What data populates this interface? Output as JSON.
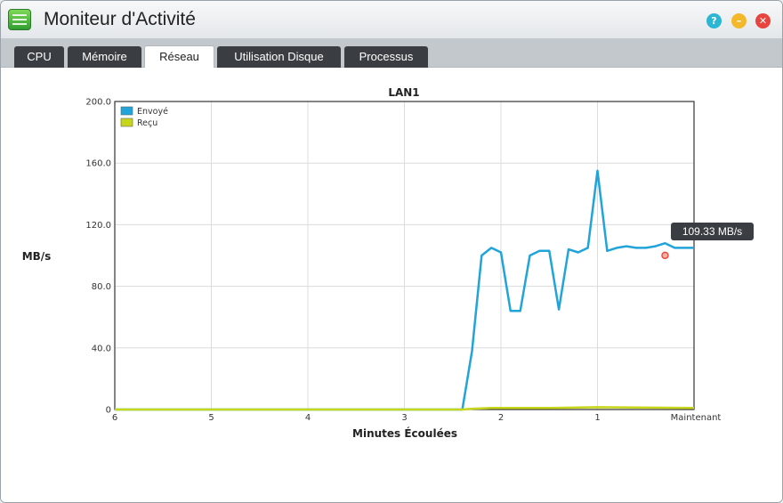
{
  "window": {
    "title": "Moniteur d'Activité"
  },
  "tabs": [
    {
      "label": "CPU"
    },
    {
      "label": "Mémoire"
    },
    {
      "label": "Réseau"
    },
    {
      "label": "Utilisation Disque"
    },
    {
      "label": "Processus"
    }
  ],
  "active_tab": "Réseau",
  "colors": {
    "sent": "#20a4d9",
    "received": "#c7d61a",
    "marker": "#e84c3d"
  },
  "tooltip": {
    "text": "109.33 MB/s"
  },
  "chart_data": {
    "type": "line",
    "title": "LAN1",
    "xlabel": "Minutes Écoulées",
    "ylabel": "MB/s",
    "ylim": [
      0,
      200
    ],
    "yticks": [
      "0",
      "40.0",
      "80.0",
      "120.0",
      "160.0",
      "200.0"
    ],
    "xticks": [
      "6",
      "5",
      "4",
      "3",
      "2",
      "1",
      "Maintenant"
    ],
    "xlim": [
      6,
      0
    ],
    "grid": true,
    "legend_position": "top-left",
    "series": [
      {
        "name": "Envoyé",
        "x": [
          6,
          2.4,
          2.3,
          2.2,
          2.1,
          2.0,
          1.9,
          1.8,
          1.7,
          1.6,
          1.5,
          1.4,
          1.3,
          1.2,
          1.1,
          1.0,
          0.9,
          0.8,
          0.7,
          0.6,
          0.5,
          0.4,
          0.3,
          0.2,
          0.1,
          0
        ],
        "y": [
          0,
          0,
          38,
          100,
          105,
          102,
          64,
          64,
          100,
          103,
          103,
          65,
          104,
          102,
          105,
          155,
          103,
          105,
          106,
          105,
          105,
          106,
          108,
          105,
          105,
          105
        ]
      },
      {
        "name": "Reçu",
        "x": [
          6,
          2.4,
          2.3,
          2.1,
          1.5,
          1.0,
          0
        ],
        "y": [
          0,
          0,
          0.5,
          1,
          1,
          1.5,
          1
        ]
      }
    ],
    "highlight": {
      "series": "Envoyé",
      "x": 0.3,
      "y": 109.33
    }
  }
}
